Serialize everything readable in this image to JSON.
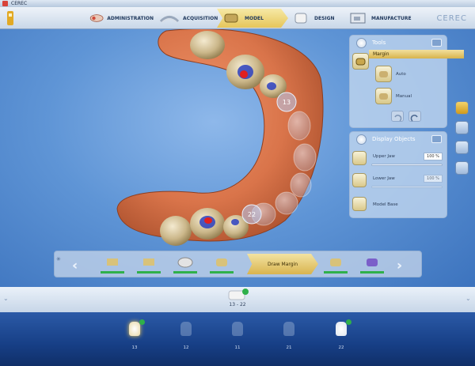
{
  "window": {
    "title": "CEREC"
  },
  "brand": "CEREC",
  "phases": [
    {
      "label": "ADMINISTRATION"
    },
    {
      "label": "ACQUISITION"
    },
    {
      "label": "MODEL"
    },
    {
      "label": "DESIGN"
    },
    {
      "label": "MANUFACTURE"
    }
  ],
  "active_phase": "MODEL",
  "tools_panel": {
    "title": "Tools",
    "selected": "Margin",
    "auto_label": "Auto",
    "manual_label": "Manual"
  },
  "display_panel": {
    "title": "Display Objects",
    "items": [
      {
        "label": "Upper Jaw",
        "value": "100 %"
      },
      {
        "label": "Lower Jaw",
        "value": "100 %"
      },
      {
        "label": "Model Base",
        "value": ""
      }
    ]
  },
  "scene": {
    "tooth_labels": [
      "13",
      "22"
    ]
  },
  "toolstrip": {
    "active_label": "Draw Margin"
  },
  "restoration": {
    "label": "13 - 22"
  },
  "tooth_selector": {
    "teeth": [
      "13",
      "12",
      "11",
      "21",
      "22"
    ]
  },
  "colors": {
    "accent_gold": "#d9b44f",
    "status_green": "#2fb04a",
    "background_blue": "#3f78c4",
    "gingiva": "#d9744a"
  }
}
